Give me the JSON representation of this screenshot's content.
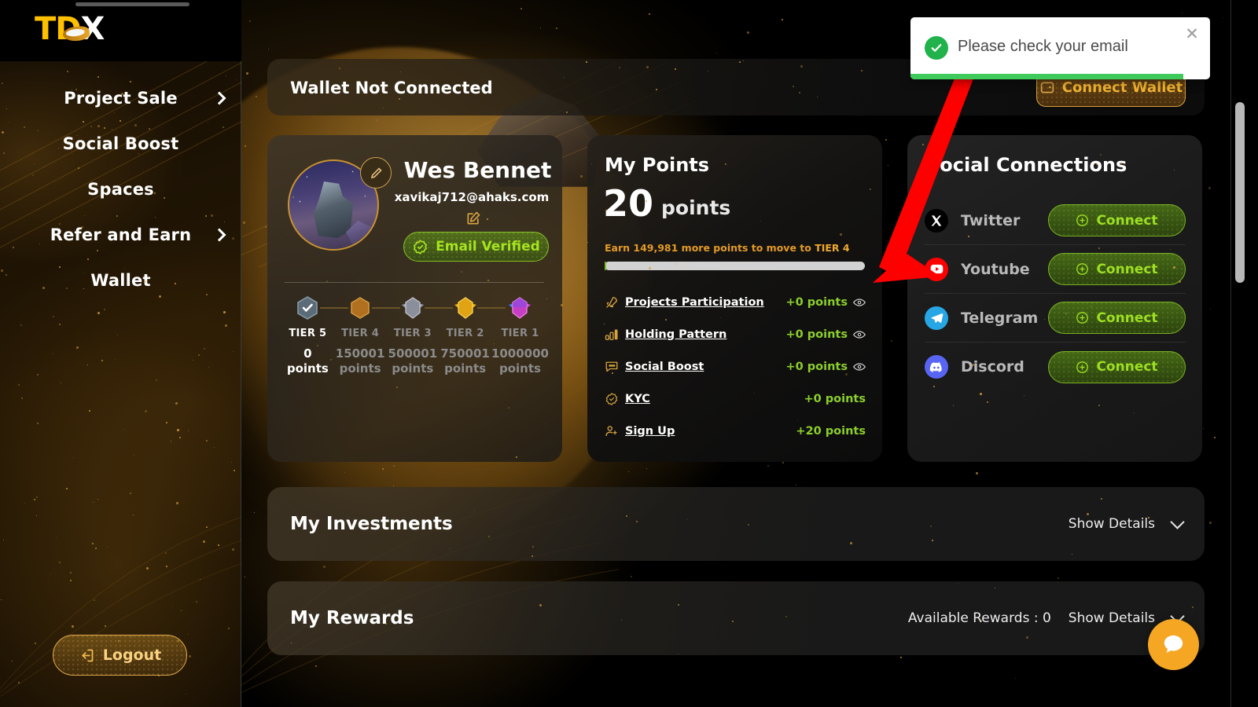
{
  "brand": {
    "logo_text": "TDX",
    "logo_part_1": "TD",
    "logo_part_2": "X"
  },
  "sidebar": {
    "items": [
      {
        "label": "Project Sale",
        "has_chevron": true,
        "icon": "chevron-right-icon"
      },
      {
        "label": "Social Boost",
        "has_chevron": false,
        "icon": ""
      },
      {
        "label": "Spaces",
        "has_chevron": false,
        "icon": ""
      },
      {
        "label": "Refer and Earn",
        "has_chevron": true,
        "icon": "chevron-right-icon"
      },
      {
        "label": "Wallet",
        "has_chevron": false,
        "icon": ""
      }
    ],
    "logout": {
      "label": "Logout",
      "icon": "logout-icon"
    }
  },
  "wallet_bar": {
    "status": "Wallet Not Connected",
    "connect_button": {
      "label": "Connect Wallet",
      "icon": "wallet-icon"
    }
  },
  "profile": {
    "name": "Wes Bennet",
    "email": "xavikaj712@ahaks.com",
    "avatar_alt": "user-avatar",
    "avatar_edit_icon": "pencil-icon",
    "email_edit_icon": "edit-square-icon",
    "verified_badge": {
      "label": "Email Verified",
      "icon": "verified-check-icon",
      "color": "#a4e41f"
    },
    "tiers": [
      {
        "name": "TIER 5",
        "points": "0",
        "unit": "points",
        "active": true,
        "color": "#5b6b78"
      },
      {
        "name": "TIER 4",
        "points": "150001",
        "unit": "points",
        "active": false,
        "color": "#b8702a"
      },
      {
        "name": "TIER 3",
        "points": "500001",
        "unit": "points",
        "active": false,
        "color": "#8d8f9b"
      },
      {
        "name": "TIER 2",
        "points": "750001",
        "unit": "points",
        "active": false,
        "color": "#e0a81a"
      },
      {
        "name": "TIER 1",
        "points": "1000000",
        "unit": "points",
        "active": false,
        "color": "#c93ec0"
      }
    ]
  },
  "points": {
    "title": "My Points",
    "value": "20",
    "unit": "points",
    "hint_prefix": "Earn 149,981 more points to move to ",
    "hint_tier": "TIER 4",
    "progress_percent": 0,
    "accent_color": "#e39a25",
    "items": [
      {
        "label": "Projects Participation",
        "amount": "+0 points",
        "icon": "rocket-icon",
        "has_eye": true
      },
      {
        "label": "Holding Pattern",
        "amount": "+0 points",
        "icon": "bar-chart-icon",
        "has_eye": true
      },
      {
        "label": "Social Boost",
        "amount": "+0 points",
        "icon": "chat-bubble-icon",
        "has_eye": true
      },
      {
        "label": "KYC",
        "amount": "+0 points",
        "icon": "verified-check-icon",
        "has_eye": false
      },
      {
        "label": "Sign Up",
        "amount": "+20 points",
        "icon": "user-plus-icon",
        "has_eye": false
      }
    ]
  },
  "social": {
    "title": "Social Connections",
    "items": [
      {
        "name": "Twitter",
        "icon": "twitter-x-icon",
        "button": "Connect",
        "brand_color": "#000000"
      },
      {
        "name": "Youtube",
        "icon": "youtube-icon",
        "button": "Connect",
        "brand_color": "#ff0000"
      },
      {
        "name": "Telegram",
        "icon": "telegram-icon",
        "button": "Connect",
        "brand_color": "#27a6e5"
      },
      {
        "name": "Discord",
        "icon": "discord-icon",
        "button": "Connect",
        "brand_color": "#5865f2"
      }
    ]
  },
  "accordions": [
    {
      "title": "My Investments",
      "meta": "",
      "show_label": "Show Details",
      "icon": "chevron-down-icon"
    },
    {
      "title": "My Rewards",
      "meta": "Available Rewards : 0",
      "show_label": "Show Details",
      "icon": "chevron-down-icon"
    }
  ],
  "toast": {
    "message": "Please check your email",
    "icon": "success-check-icon",
    "close_icon": "close-icon",
    "progress_percent": 91,
    "bar_color": "#3ecb5c"
  },
  "chat_widget": {
    "icon": "chat-bubble-icon",
    "color": "#f5a623"
  },
  "annotation": {
    "type": "arrow",
    "color": "#ff0000"
  }
}
